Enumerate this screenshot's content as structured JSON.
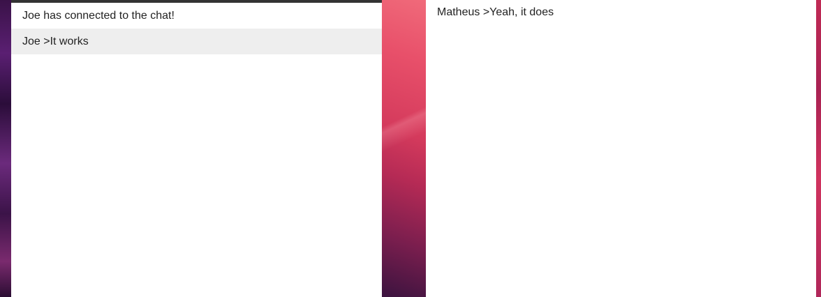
{
  "left_window": {
    "messages": [
      "Joe has connected to the chat!",
      "Joe >It works"
    ]
  },
  "right_window": {
    "messages": [
      "Matheus >Yeah, it does"
    ]
  }
}
